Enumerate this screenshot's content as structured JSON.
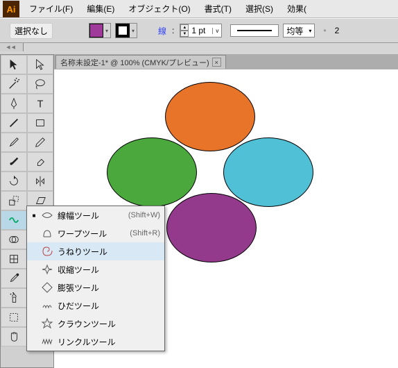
{
  "app_initials": "Ai",
  "menu": {
    "file": "ファイル(F)",
    "edit": "編集(E)",
    "object": "オブジェクト(O)",
    "type": "書式(T)",
    "select": "選択(S)",
    "effect": "効果("
  },
  "ctrl": {
    "selection": "選択なし",
    "stroke_label": "線",
    "colon": ":",
    "stroke_weight": "1 pt",
    "profile": "均等",
    "opac": "2"
  },
  "tab": {
    "title": "名称未設定-1* @ 100% (CMYK/プレビュー)",
    "close": "×"
  },
  "flyout": {
    "items": [
      {
        "label": "線幅ツール",
        "sc": "(Shift+W)",
        "sel": false,
        "mark": "■"
      },
      {
        "label": "ワープツール",
        "sc": "(Shift+R)",
        "sel": false,
        "mark": ""
      },
      {
        "label": "うねりツール",
        "sc": "",
        "sel": true,
        "mark": ""
      },
      {
        "label": "収縮ツール",
        "sc": "",
        "sel": false,
        "mark": ""
      },
      {
        "label": "膨張ツール",
        "sc": "",
        "sel": false,
        "mark": ""
      },
      {
        "label": "ひだツール",
        "sc": "",
        "sel": false,
        "mark": ""
      },
      {
        "label": "クラウンツール",
        "sc": "",
        "sel": false,
        "mark": ""
      },
      {
        "label": "リンクルツール",
        "sc": "",
        "sel": false,
        "mark": ""
      }
    ]
  }
}
